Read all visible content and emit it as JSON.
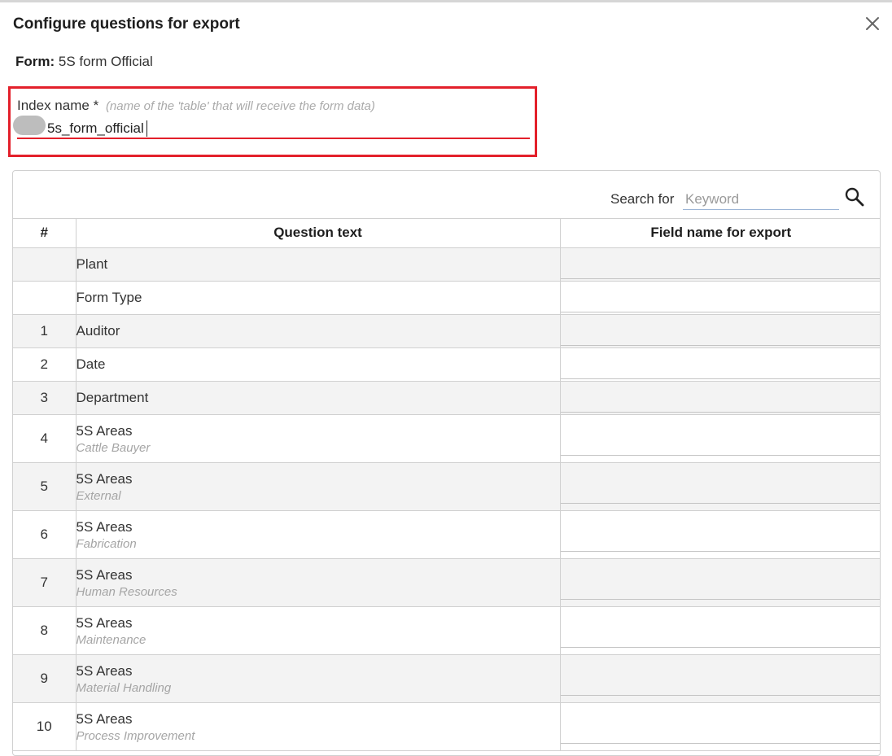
{
  "dialog": {
    "title": "Configure questions for export",
    "close_icon": "close-icon"
  },
  "form": {
    "label": "Form:",
    "value": "5S form Official"
  },
  "index_name": {
    "label": "Index name",
    "required_mark": "*",
    "hint": "(name of the 'table' that will receive the form data)",
    "value": "5s_form_official"
  },
  "search": {
    "label": "Search for",
    "placeholder": "Keyword",
    "icon": "search-icon"
  },
  "table": {
    "headers": [
      "#",
      "Question text",
      "Field name for export"
    ],
    "rows": [
      {
        "num": "",
        "question": "Plant",
        "sub": "",
        "field": ""
      },
      {
        "num": "",
        "question": "Form Type",
        "sub": "",
        "field": ""
      },
      {
        "num": "1",
        "question": "Auditor",
        "sub": "",
        "field": ""
      },
      {
        "num": "2",
        "question": "Date",
        "sub": "",
        "field": ""
      },
      {
        "num": "3",
        "question": "Department",
        "sub": "",
        "field": ""
      },
      {
        "num": "4",
        "question": "5S Areas",
        "sub": "Cattle Bauyer",
        "field": ""
      },
      {
        "num": "5",
        "question": "5S Areas",
        "sub": "External",
        "field": ""
      },
      {
        "num": "6",
        "question": "5S Areas",
        "sub": "Fabrication",
        "field": ""
      },
      {
        "num": "7",
        "question": "5S Areas",
        "sub": "Human Resources",
        "field": ""
      },
      {
        "num": "8",
        "question": "5S Areas",
        "sub": "Maintenance",
        "field": ""
      },
      {
        "num": "9",
        "question": "5S Areas",
        "sub": "Material Handling",
        "field": ""
      },
      {
        "num": "10",
        "question": "5S Areas",
        "sub": "Process Improvement",
        "field": ""
      }
    ]
  },
  "colors": {
    "highlight_border": "#e3202b",
    "row_shade": "#f3f3f3",
    "grid": "#d0d0d0"
  }
}
